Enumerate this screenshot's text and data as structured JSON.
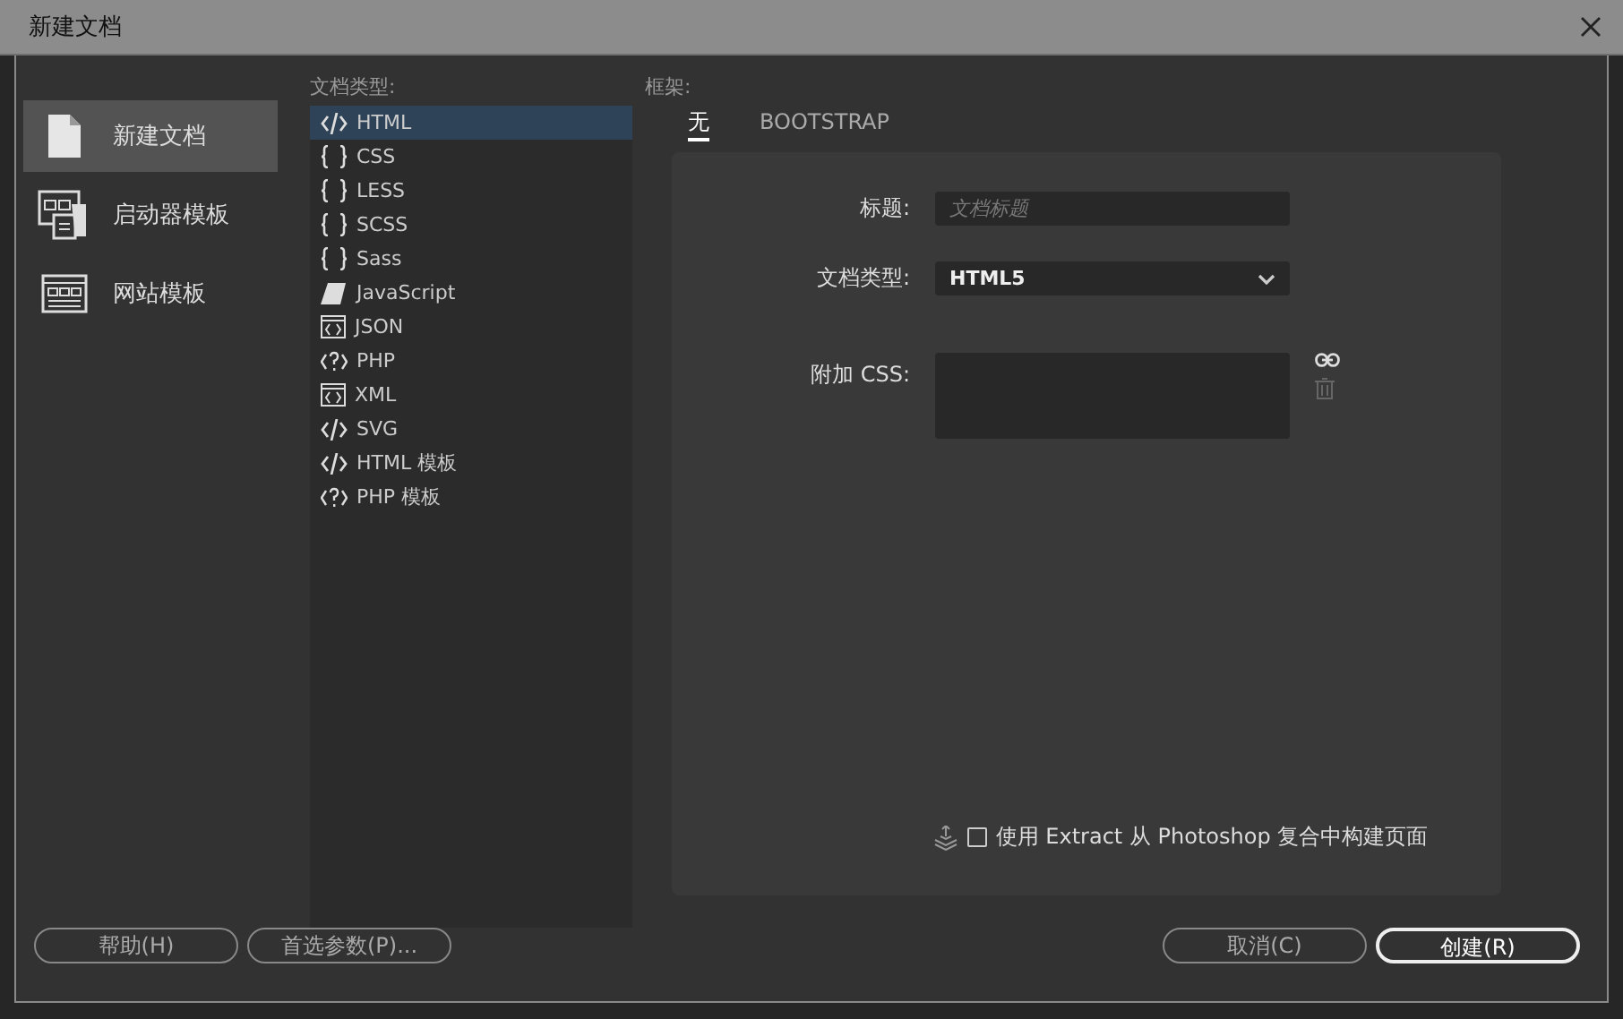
{
  "window": {
    "title": "新建文档"
  },
  "sidebar": {
    "items": [
      {
        "label": "新建文档",
        "kind": "page",
        "selected": true
      },
      {
        "label": "启动器模板",
        "kind": "starter",
        "selected": false
      },
      {
        "label": "网站模板",
        "kind": "site",
        "selected": false
      }
    ]
  },
  "doc_types": {
    "heading": "文档类型:",
    "items": [
      {
        "label": "HTML",
        "kind": "markup",
        "selected": true
      },
      {
        "label": "CSS",
        "kind": "style",
        "selected": false
      },
      {
        "label": "LESS",
        "kind": "style",
        "selected": false
      },
      {
        "label": "SCSS",
        "kind": "style",
        "selected": false
      },
      {
        "label": "Sass",
        "kind": "style",
        "selected": false
      },
      {
        "label": "JavaScript",
        "kind": "script",
        "selected": false
      },
      {
        "label": "JSON",
        "kind": "data",
        "selected": false
      },
      {
        "label": "PHP",
        "kind": "server",
        "selected": false
      },
      {
        "label": "XML",
        "kind": "data",
        "selected": false
      },
      {
        "label": "SVG",
        "kind": "markup",
        "selected": false
      },
      {
        "label": "HTML 模板",
        "kind": "markup",
        "selected": false
      },
      {
        "label": "PHP 模板",
        "kind": "server",
        "selected": false
      }
    ]
  },
  "framework": {
    "heading": "框架:",
    "tabs": [
      {
        "label": "无",
        "selected": true
      },
      {
        "label": "BOOTSTRAP",
        "selected": false
      }
    ],
    "title_field": {
      "label": "标题:",
      "placeholder": "文档标题"
    },
    "doctype_field": {
      "label": "文档类型:",
      "value": "HTML5"
    },
    "css_field": {
      "label": "附加 CSS:"
    },
    "extract": {
      "label": "使用 Extract 从 Photoshop 复合中构建页面",
      "checked": false
    }
  },
  "buttons": {
    "left": [
      "帮助(H)",
      "首选参数(P)..."
    ],
    "right": [
      {
        "label": "取消(C)",
        "primary": false
      },
      {
        "label": "创建(R)",
        "primary": true
      }
    ]
  }
}
